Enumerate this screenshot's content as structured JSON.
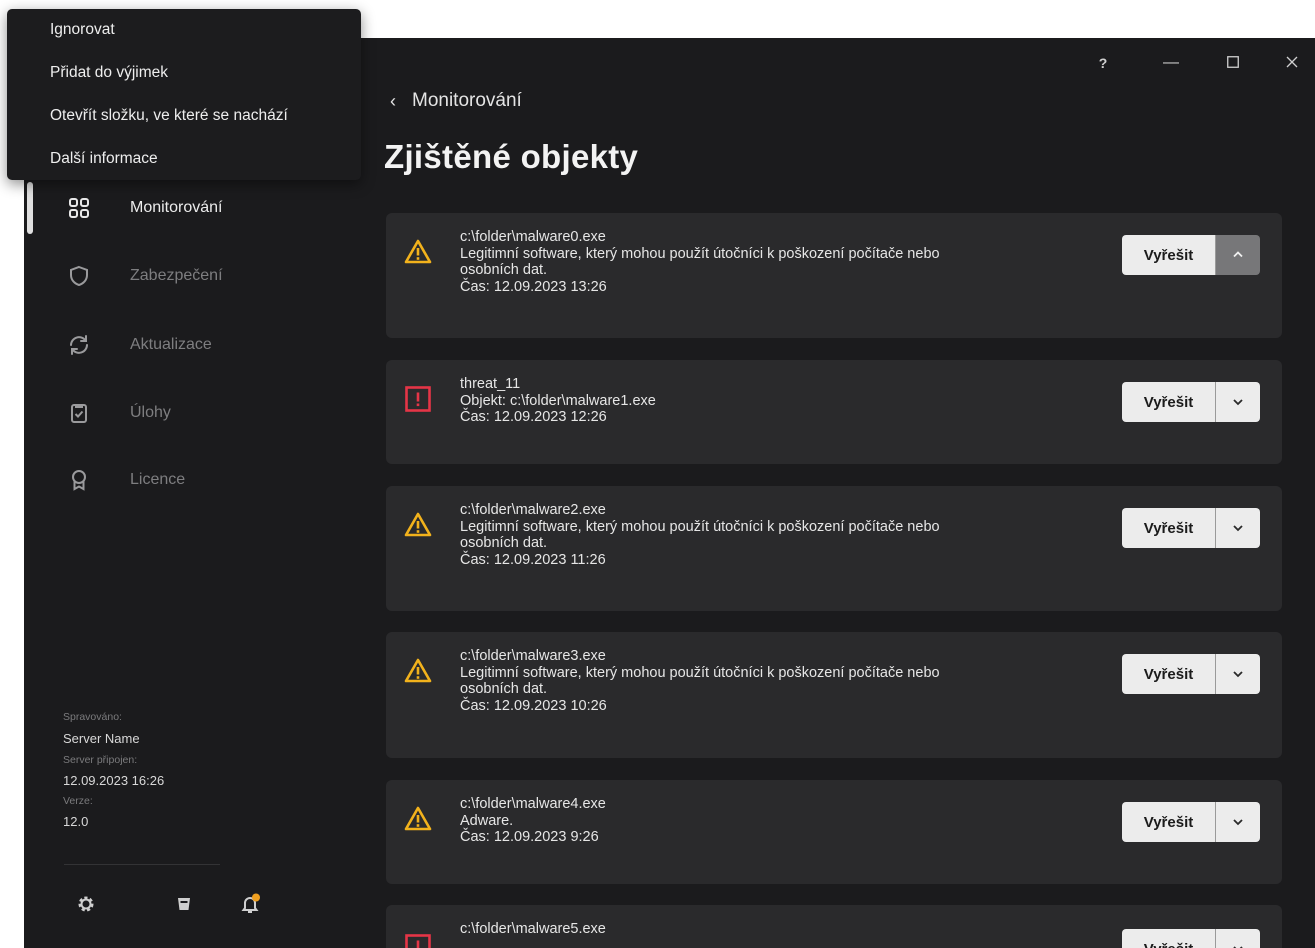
{
  "window": {
    "help_label": "?",
    "minimize_label": "—"
  },
  "context_menu": {
    "items": [
      {
        "label": "Ignorovat"
      },
      {
        "label": "Přidat do výjimek"
      },
      {
        "label": "Otevřít složku, ve které se nachází"
      },
      {
        "label": "Další informace"
      }
    ]
  },
  "sidebar": {
    "items": [
      {
        "label": "Monitorování",
        "icon": "dashboard-icon",
        "active": true
      },
      {
        "label": "Zabezpečení",
        "icon": "shield-icon",
        "active": false
      },
      {
        "label": "Aktualizace",
        "icon": "refresh-icon",
        "active": false
      },
      {
        "label": "Úlohy",
        "icon": "clipboard-icon",
        "active": false
      },
      {
        "label": "Licence",
        "icon": "license-award-icon",
        "active": false
      }
    ],
    "managed_label": "Spravováno:",
    "managed_value": "Server Name",
    "connected_label": "Server připojen:",
    "connected_value": "12.09.2023 16:26",
    "version_label": "Verze:",
    "version_value": "12.0",
    "bottom_icons": [
      "gear-icon",
      "support-icon",
      "notification-bell-icon"
    ]
  },
  "header": {
    "back_label": "Monitorování",
    "title": "Zjištěné objekty"
  },
  "colors": {
    "warning": "#f2b21c",
    "danger": "#e53547",
    "notification_dot": "#f0a020"
  },
  "detections": [
    {
      "severity": "warning",
      "title": "c:\\folder\\malware0.exe",
      "line1": "Legitimní software, který mohou použít útočníci k poškození počítače nebo",
      "line2": "osobních dat.",
      "time": "Čas: 12.09.2023 13:26",
      "action": "Vyřešit",
      "menu_open": true
    },
    {
      "severity": "danger",
      "title": "threat_11",
      "line1": "Objekt: c:\\folder\\malware1.exe",
      "line2": "",
      "time": "Čas: 12.09.2023 12:26",
      "action": "Vyřešit",
      "menu_open": false
    },
    {
      "severity": "warning",
      "title": "c:\\folder\\malware2.exe",
      "line1": "Legitimní software, který mohou použít útočníci k poškození počítače nebo",
      "line2": "osobních dat.",
      "time": "Čas: 12.09.2023 11:26",
      "action": "Vyřešit",
      "menu_open": false
    },
    {
      "severity": "warning",
      "title": "c:\\folder\\malware3.exe",
      "line1": "Legitimní software, který mohou použít útočníci k poškození počítače nebo",
      "line2": "osobních dat.",
      "time": "Čas: 12.09.2023 10:26",
      "action": "Vyřešit",
      "menu_open": false
    },
    {
      "severity": "warning",
      "title": "c:\\folder\\malware4.exe",
      "line1": "Adware.",
      "line2": "",
      "time": "Čas: 12.09.2023 9:26",
      "action": "Vyřešit",
      "menu_open": false
    },
    {
      "severity": "danger",
      "title": "c:\\folder\\malware5.exe",
      "line1": "",
      "line2": "",
      "time": "",
      "action": "Vyřešit",
      "menu_open": false
    }
  ]
}
